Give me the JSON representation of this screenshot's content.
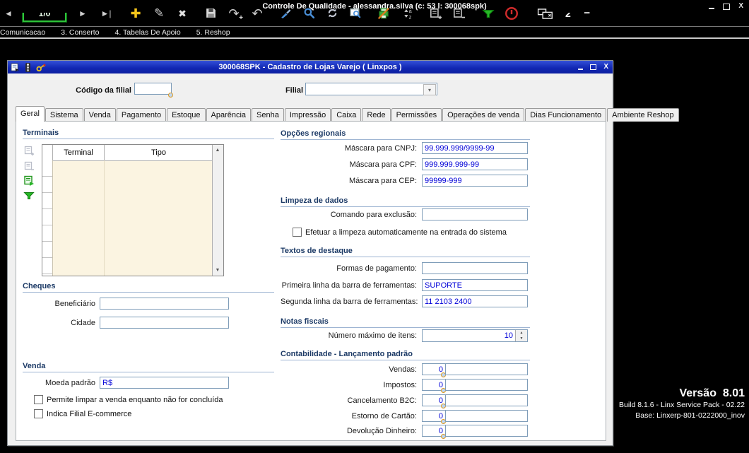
{
  "window": {
    "title": "Controle De Qualidade - alessandra.silva (c: 53 l: 300068spk)",
    "close_glyph": "X"
  },
  "toolbar": {
    "prev_icon": "◄",
    "record_counter": "1/0",
    "next_icon": "►",
    "last_icon": "►|",
    "add_glyph": "✚",
    "edit_glyph": "✎",
    "delete_glyph": "✖",
    "redo_glyph": "↷",
    "redo_plus": "+",
    "undo_glyph": "↶",
    "window_count": "2",
    "minus_glyph": "−"
  },
  "menu_tabs": [
    "Comunicacao",
    "3. Conserto",
    "4. Tabelas De Apoio",
    "5. Reshop"
  ],
  "dialog": {
    "title": "300068SPK - Cadastro de Lojas Varejo ( Linxpos )",
    "close_glyph": "X",
    "header_fields": {
      "codigo_label": "Código da filial",
      "codigo_value": "",
      "filial_label": "Filial",
      "filial_value": ""
    },
    "tabs": [
      "Geral",
      "Sistema",
      "Venda",
      "Pagamento",
      "Estoque",
      "Aparência",
      "Senha",
      "Impressão",
      "Caixa",
      "Rede",
      "Permissões",
      "Operações de venda",
      "Dias Funcionamento",
      "Ambiente Reshop"
    ],
    "active_tab": "Geral",
    "terminais": {
      "title": "Terminais",
      "col_terminal": "Terminal",
      "col_tipo": "Tipo",
      "rows": []
    },
    "cheques": {
      "title": "Cheques",
      "beneficiario_label": "Beneficiário",
      "beneficiario_value": "",
      "cidade_label": "Cidade",
      "cidade_value": ""
    },
    "venda": {
      "title": "Venda",
      "moeda_label": "Moeda padrão",
      "moeda_value": "R$",
      "chk_limpar_label": "Permite limpar a venda enquanto não for concluída",
      "chk_limpar_checked": false,
      "chk_ecommerce_label": "Indica Filial E-commerce",
      "chk_ecommerce_checked": false
    },
    "opcoes_regionais": {
      "title": "Opções regionais",
      "cnpj_label": "Máscara para CNPJ:",
      "cnpj_value": "99.999.999/9999-99",
      "cpf_label": "Máscara para CPF:",
      "cpf_value": "999.999.999-99",
      "cep_label": "Máscara para CEP:",
      "cep_value": "99999-999"
    },
    "limpeza": {
      "title": "Limpeza de dados",
      "comando_label": "Comando para exclusão:",
      "comando_value": "",
      "chk_auto_label": "Efetuar a limpeza automaticamente na entrada do sistema",
      "chk_auto_checked": false
    },
    "textos": {
      "title": "Textos de destaque",
      "formas_label": "Formas de pagamento:",
      "formas_value": "",
      "linha1_label": "Primeira linha da barra de ferramentas:",
      "linha1_value": "SUPORTE",
      "linha2_label": "Segunda linha da barra de ferramentas:",
      "linha2_value": "11 2103 2400"
    },
    "notas": {
      "title": "Notas fiscais",
      "max_itens_label": "Número máximo de itens:",
      "max_itens_value": "10"
    },
    "contabilidade": {
      "title": "Contabilidade - Lançamento padrão",
      "rows": [
        {
          "label": "Vendas:",
          "code": "0",
          "desc": ""
        },
        {
          "label": "Impostos:",
          "code": "0",
          "desc": ""
        },
        {
          "label": "Cancelamento B2C:",
          "code": "0",
          "desc": ""
        },
        {
          "label": "Estorno de Cartão:",
          "code": "0",
          "desc": ""
        },
        {
          "label": "Devolução Dinheiro:",
          "code": "0",
          "desc": ""
        }
      ]
    }
  },
  "desktop": {
    "version": "Versão  8.01",
    "build": "Build 8.1.6 - Linx Service Pack - 02.22",
    "base": "Base: Linxerp-801-0222000_inov"
  },
  "colors": {
    "titlebar_blue": "#1228b4",
    "value_blue": "#0000d8",
    "counter_green": "#2ec43a",
    "filter_green": "#1fae1f",
    "grid_cream": "#fbf4e1",
    "add_yellow": "#f5c51b",
    "stop_red": "#cc2a2a"
  }
}
